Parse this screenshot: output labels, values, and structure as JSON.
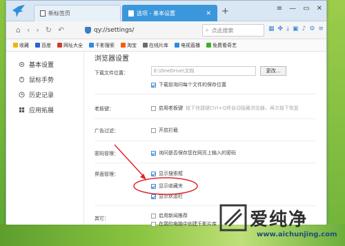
{
  "colors": {
    "accent": "#3b97dc",
    "annotation_red": "#e0242b",
    "checkbox_check": "#2a6fb5"
  },
  "tabs": [
    {
      "label": "新标签页",
      "icon": "page-icon"
    },
    {
      "label": "选项 - 基本设置",
      "icon": "page-icon"
    }
  ],
  "address": {
    "url": "qy://settings/",
    "search_placeholder": "点此搜索"
  },
  "bookmarks": [
    {
      "label": "收藏",
      "icon": "star-icon",
      "color": "#f0b400"
    },
    {
      "label": "百度",
      "icon": "baidu-icon",
      "color": "#2b61d8"
    },
    {
      "label": "网址大全",
      "icon": "site-icon",
      "color": "#d23b2b"
    },
    {
      "label": "千影搜索",
      "icon": "search-icon",
      "color": "#2e8be0"
    },
    {
      "label": "淘宝",
      "icon": "taobao-icon",
      "color": "#ff5a00"
    },
    {
      "label": "在线片库",
      "icon": "film-icon",
      "color": "#6c6c6c"
    },
    {
      "label": "电视直播",
      "icon": "tv-icon",
      "color": "#2e8be0"
    },
    {
      "label": "免费看奇艺",
      "icon": "video-icon",
      "color": "#3fae2a"
    }
  ],
  "sidebar": {
    "items": [
      {
        "label": "基本设置"
      },
      {
        "label": "鼠标手势"
      },
      {
        "label": "历史记录"
      },
      {
        "label": "应用拓展"
      }
    ]
  },
  "settings": {
    "title": "浏览器设置",
    "download": {
      "label": "下载文件位置：",
      "path": "E:\\OneDrive\\文档",
      "change": "更改...",
      "ask": "下载前询问每个文件的保存位置"
    },
    "bosskey": {
      "label": "老板键：",
      "option": "启用老板键",
      "hint": "按下快捷键Ctrl+Q将自动隐藏浏览器，再次按下恢复"
    },
    "adblock": {
      "label": "广告过滤：",
      "option": "开启拦截"
    },
    "password": {
      "label": "密码管理：",
      "option": "询问是否保存您在网页上输入的密码"
    },
    "ui": {
      "label": "界面管理：",
      "options": [
        "显示搜索框",
        "显示收藏夹",
        "显示状态栏"
      ]
    },
    "other": {
      "label": "其它：",
      "options": [
        "启用新闻推荐",
        "在我的电脑中创建千影片库"
      ]
    }
  },
  "watermark": {
    "brand": "爱纯净",
    "url": "www.aichunjing.com"
  }
}
